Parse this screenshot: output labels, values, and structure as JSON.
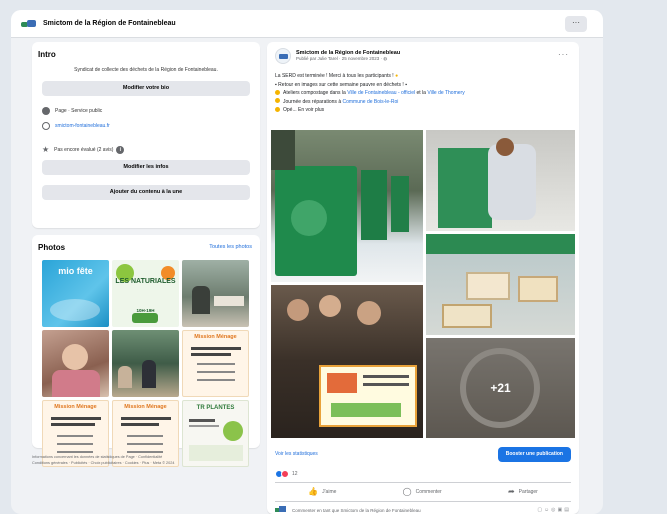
{
  "page": {
    "name": "Smictom de la Région de Fontainebleau",
    "more_label": "···"
  },
  "intro": {
    "heading": "Intro",
    "description": "Syndicat de collecte des déchets de la Région de Fontainebleau.",
    "edit_bio_label": "Modifier votre bio",
    "page_type": "Page · Service public",
    "website": "smictom-fontainebleau.fr",
    "rating": "Pas encore évalué (2 avis)",
    "edit_info_label": "Modifier les infos",
    "add_content_label": "Ajouter du contenu à la une"
  },
  "photos": {
    "heading": "Photos",
    "see_all": "Toutes les photos",
    "items": [
      {
        "name": "mio-fete-photo",
        "caption": "mio fête"
      },
      {
        "name": "les-naturiales-photo",
        "caption": "LES NATURIALES",
        "sub": "10H-19H"
      },
      {
        "name": "workshop-room-photo",
        "caption": ""
      },
      {
        "name": "child-activity-photo",
        "caption": ""
      },
      {
        "name": "classroom-photo",
        "caption": ""
      },
      {
        "name": "mission-menage-photo-1",
        "caption": "Mission Ménage"
      },
      {
        "name": "mission-menage-photo-2",
        "caption": "Mission Ménage"
      },
      {
        "name": "mission-menage-photo-3",
        "caption": "Mission Ménage"
      },
      {
        "name": "plantes-photo",
        "caption": "TR  PLANTES"
      }
    ]
  },
  "footer": {
    "line1": "Informations concernant les données de statistiques de Page · Confidentialité",
    "line2": "Conditions générales · Publicités · Choix publicitaires · Cookies · Plus · Meta © 2024"
  },
  "post": {
    "author": "Smictom de la Région de Fontainebleau",
    "meta": "Publié par Julie Tarel · 25 novembre 2023 · ",
    "more_label": "···",
    "line1": "La SERD est terminée ! Merci à tous les participants ! ",
    "line2": "Retour en images sur cette semaine pauvre en déchets ! ",
    "item1_a": "Ateliers compostage dans la ",
    "item1_link1": "Ville de Fontainebleau - officiel",
    "item1_b": " et la ",
    "item1_link2": "Ville de Thomery",
    "item2_a": "Journée des réparations à ",
    "item2_link": "Commune de Bois-le-Roi",
    "item3": "Opé... En voir plus",
    "more_photos": "+21",
    "stats_link": "Voir les statistiques",
    "boost_label": "Booster une publication",
    "reaction_count": "12",
    "like_label": "J'aime",
    "comment_label": "Commenter",
    "share_label": "Partager",
    "comment_placeholder": "Commenter en tant que Smictom de la Région de Fontainebleau"
  },
  "colors": {
    "accent": "#1b74e4",
    "link": "#216fdb",
    "background": "#f0f2f5"
  }
}
